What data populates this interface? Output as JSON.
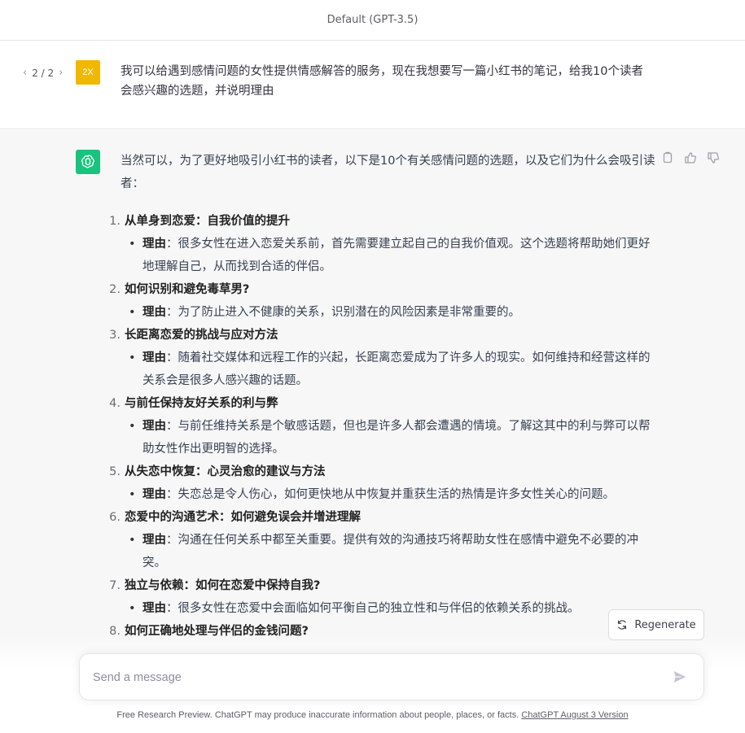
{
  "header": {
    "model_title": "Default (GPT-3.5)"
  },
  "user_message": {
    "pager": "2 / 2",
    "avatar_initials": "2X",
    "text": "我可以给遇到感情问题的女性提供情感解答的服务，现在我想要写一篇小红书的笔记，给我10个读者会感兴趣的选题，并说明理由"
  },
  "assistant_message": {
    "intro": "当然可以，为了更好地吸引小红书的读者，以下是10个有关感情问题的选题，以及它们为什么会吸引读者：",
    "reason_label": "理由",
    "items": [
      {
        "num": "1.",
        "title": "从单身到恋爱：自我价值的提升",
        "reason": "：很多女性在进入恋爱关系前，首先需要建立起自己的自我价值观。这个选题将帮助她们更好地理解自己，从而找到合适的伴侣。"
      },
      {
        "num": "2.",
        "title": "如何识别和避免毒草男?",
        "reason": "：为了防止进入不健康的关系，识别潜在的风险因素是非常重要的。"
      },
      {
        "num": "3.",
        "title": "长距离恋爱的挑战与应对方法",
        "reason": "：随着社交媒体和远程工作的兴起，长距离恋爱成为了许多人的现实。如何维持和经营这样的关系会是很多人感兴趣的话题。"
      },
      {
        "num": "4.",
        "title": "与前任保持友好关系的利与弊",
        "reason": "：与前任维持关系是个敏感话题，但也是许多人都会遭遇的情境。了解这其中的利与弊可以帮助女性作出更明智的选择。"
      },
      {
        "num": "5.",
        "title": "从失恋中恢复：心灵治愈的建议与方法",
        "reason": "：失恋总是令人伤心，如何更快地从中恢复并重获生活的热情是许多女性关心的问题。"
      },
      {
        "num": "6.",
        "title": "恋爱中的沟通艺术：如何避免误会并增进理解",
        "reason": "：沟通在任何关系中都至关重要。提供有效的沟通技巧将帮助女性在感情中避免不必要的冲突。"
      },
      {
        "num": "7.",
        "title": "独立与依赖：如何在恋爱中保持自我?",
        "reason": "：很多女性在恋爱中会面临如何平衡自己的独立性和与伴侣的依赖关系的挑战。"
      },
      {
        "num": "8.",
        "title": "如何正确地处理与伴侣的金钱问题?",
        "reason": ""
      }
    ]
  },
  "regenerate_label": "Regenerate",
  "composer": {
    "placeholder": "Send a message"
  },
  "footer": {
    "text": "Free Research Preview. ChatGPT may produce inaccurate information about people, places, or facts. ",
    "link": "ChatGPT August 3 Version"
  },
  "colors": {
    "gpt_avatar": "#19c37d",
    "user_avatar": "#f0b800"
  }
}
